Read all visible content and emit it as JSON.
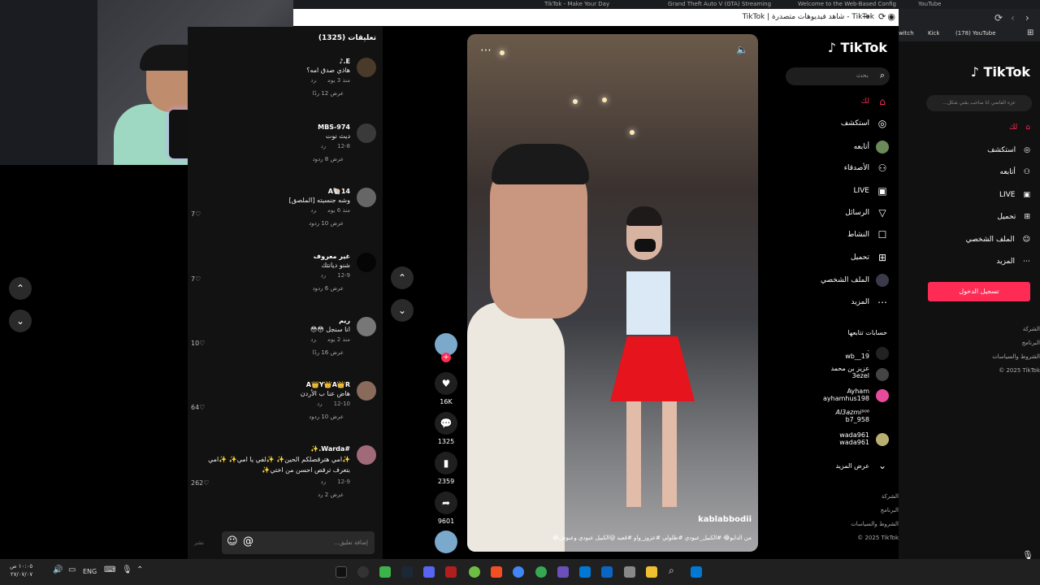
{
  "browser": {
    "tabs": [
      "TikTok - Make Your Day",
      "Grand Theft Auto V (GTA) Streaming",
      "Welcome to the Web-Based Config",
      "YouTube"
    ],
    "page_title": "TikTok | شاهد فيديوهات متصدرة - TikTok"
  },
  "bg_bookmarks": {
    "twitch": "witch",
    "kick": "Kick",
    "youtube": "(178) YouTube"
  },
  "comments": {
    "header": "تعليقات (1325)",
    "items": [
      {
        "user": "E.♪",
        "text": "هاذي صدق امه؟",
        "time": "منذ 3 يوم",
        "reply": "رد",
        "likes": "",
        "replies": "عرض 12 ردًا"
      },
      {
        "user": "MBS-974",
        "text": "ديث نوت",
        "time": "12-8",
        "reply": "رد",
        "likes": "",
        "replies": "عرض 8 ردود"
      },
      {
        "user": "A🐚14",
        "text": "وشه جنسيته [الملصق]",
        "time": "منذ 6 يوم",
        "reply": "رد",
        "likes": "7",
        "replies": "عرض 10 ردود"
      },
      {
        "user": "غير معروف",
        "text": "شنو ديانتك",
        "time": "12-9",
        "reply": "رد",
        "likes": "7",
        "replies": "عرض 6 ردود"
      },
      {
        "user": "ريم",
        "text": "انا سنجل 😳😳",
        "time": "منذ 2 يوم",
        "reply": "رد",
        "likes": "10",
        "replies": "عرض 16 ردًا"
      },
      {
        "user": "A👑Y👑A👑R",
        "text": "هاض عنا ب الأردن",
        "time": "12-10",
        "reply": "رد",
        "likes": "64",
        "replies": "عرض 10 ردود"
      },
      {
        "user": "#Warda.✨",
        "text": "✨امي هترقصلكم الحين✨ ✨لفي يا امي✨ ✨امي بتعرف ترقص احسن من اختي✨",
        "time": "12-9",
        "reply": "رد",
        "likes": "262",
        "replies": "عرض 2 رد"
      }
    ],
    "input_placeholder": "إضافة تعليق...",
    "post_label": "نشر"
  },
  "video": {
    "username": "kablabbodii",
    "caption": "من الدايو😂 #الكبيل_عبودي #طلولي #عزوز_واو #قعيد @الكبيل عبودي وعبوش😂"
  },
  "actions": {
    "likes": "16K",
    "comments": "1325",
    "saves": "2359",
    "shares": "9601"
  },
  "sidebar": {
    "logo": "TikTok",
    "search_placeholder": "بحث",
    "nav": [
      {
        "label": "لك",
        "icon": "home-icon"
      },
      {
        "label": "استكشف",
        "icon": "compass-icon"
      },
      {
        "label": "أتابعه",
        "icon": "avatar-icon"
      },
      {
        "label": "الأصدقاء",
        "icon": "friends-icon"
      },
      {
        "label": "LIVE",
        "icon": "live-icon"
      },
      {
        "label": "الرسائل",
        "icon": "send-icon"
      },
      {
        "label": "النشاط",
        "icon": "activity-icon"
      },
      {
        "label": "تحميل",
        "icon": "upload-icon"
      },
      {
        "label": "الملف الشخصي",
        "icon": "profile-icon"
      },
      {
        "label": "المزيد",
        "icon": "more-icon"
      }
    ],
    "following_title": "حسابات تتابعها",
    "following": [
      {
        "name": ".",
        "handle": "wb__19"
      },
      {
        "name": "عزيز بن محمد",
        "handle": "3ezel"
      },
      {
        "name": "Ayham",
        "handle": "ayhamhus198"
      },
      {
        "name": "Al3azmi⁹⁰⁶",
        "handle": "b7_958"
      },
      {
        "name": "wada961",
        "handle": "wada961"
      }
    ],
    "show_more": "عرض المزيد",
    "footer": [
      "الشركة",
      "البرنامج",
      "الشروط والسياسات",
      "© 2025 TikTok"
    ]
  },
  "bg_sidebar": {
    "search_placeholder": "عزه الفاضي انا صاحب بقتي شكل...",
    "nav": [
      "لك",
      "استكشف",
      "أتابعه",
      "LIVE",
      "تحميل",
      "الملف الشخصي",
      "المزيد"
    ],
    "login": "تسجيل الدخول",
    "footer": [
      "الشركة",
      "البرنامج",
      "الشروط والسياسات",
      "© 2025 TikTok"
    ]
  },
  "taskbar": {
    "lang": "ENG",
    "time": "١٠:٠٥ ص",
    "date": "٢٧/٠٧/٠٧"
  },
  "colors": {
    "accent": "#fe2c55",
    "bg": "#000000",
    "panel": "#121212"
  }
}
